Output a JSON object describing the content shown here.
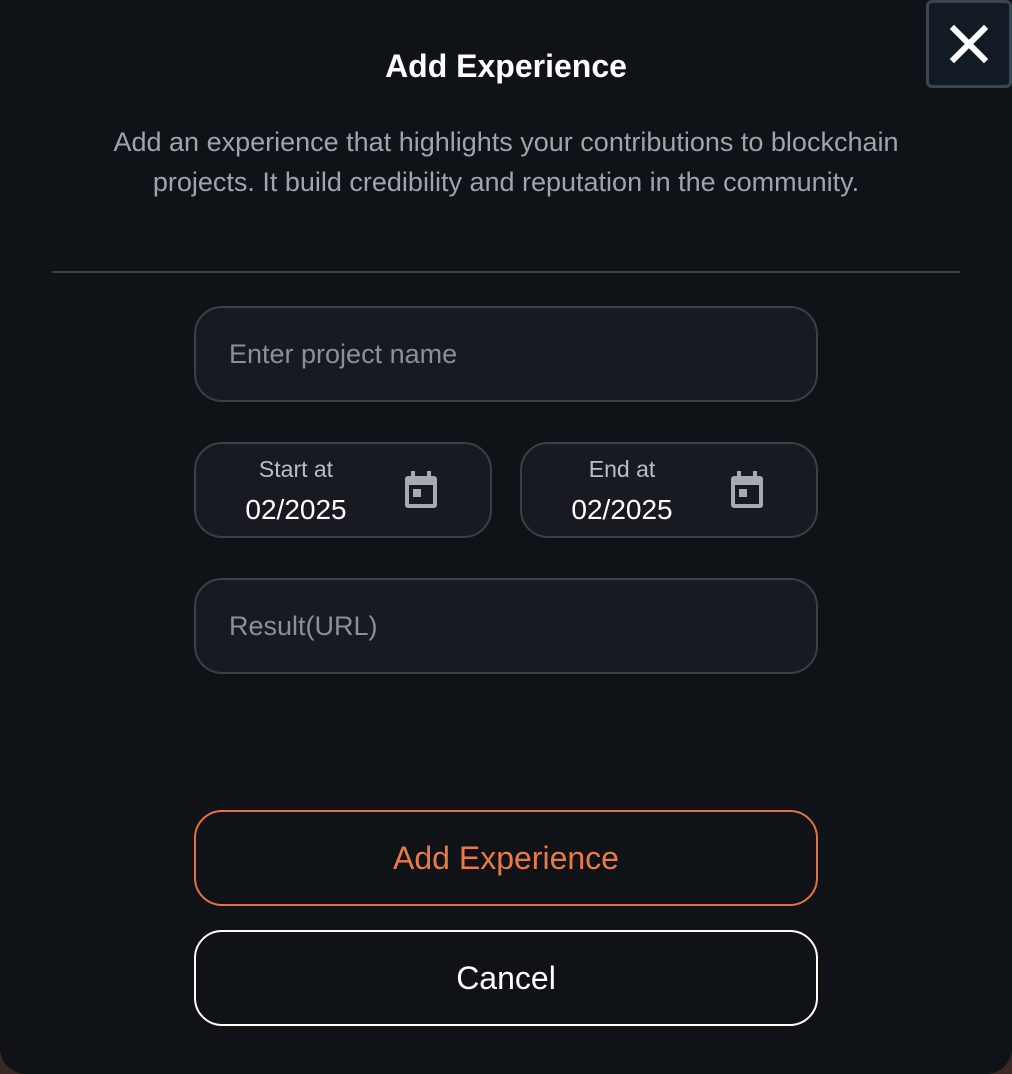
{
  "dialog": {
    "title": "Add Experience",
    "subtitle": "Add an experience that highlights your contributions to blockchain projects. It build credibility and reputation in the community."
  },
  "close_icon": "close-icon",
  "form": {
    "project_name": {
      "value": "",
      "placeholder": "Enter project name"
    },
    "start_date": {
      "label": "Start at",
      "value": "02/2025",
      "icon": "calendar-icon"
    },
    "end_date": {
      "label": "End at",
      "value": "02/2025",
      "icon": "calendar-icon"
    },
    "result_url": {
      "value": "",
      "placeholder": "Result(URL)"
    }
  },
  "actions": {
    "submit_label": "Add Experience",
    "cancel_label": "Cancel"
  },
  "colors": {
    "background": "#0f1217",
    "field_background": "#171b21",
    "field_border": "#3b3f46",
    "accent": "#e97a44",
    "text_primary": "#ffffff",
    "text_muted": "#9ea4ad"
  }
}
